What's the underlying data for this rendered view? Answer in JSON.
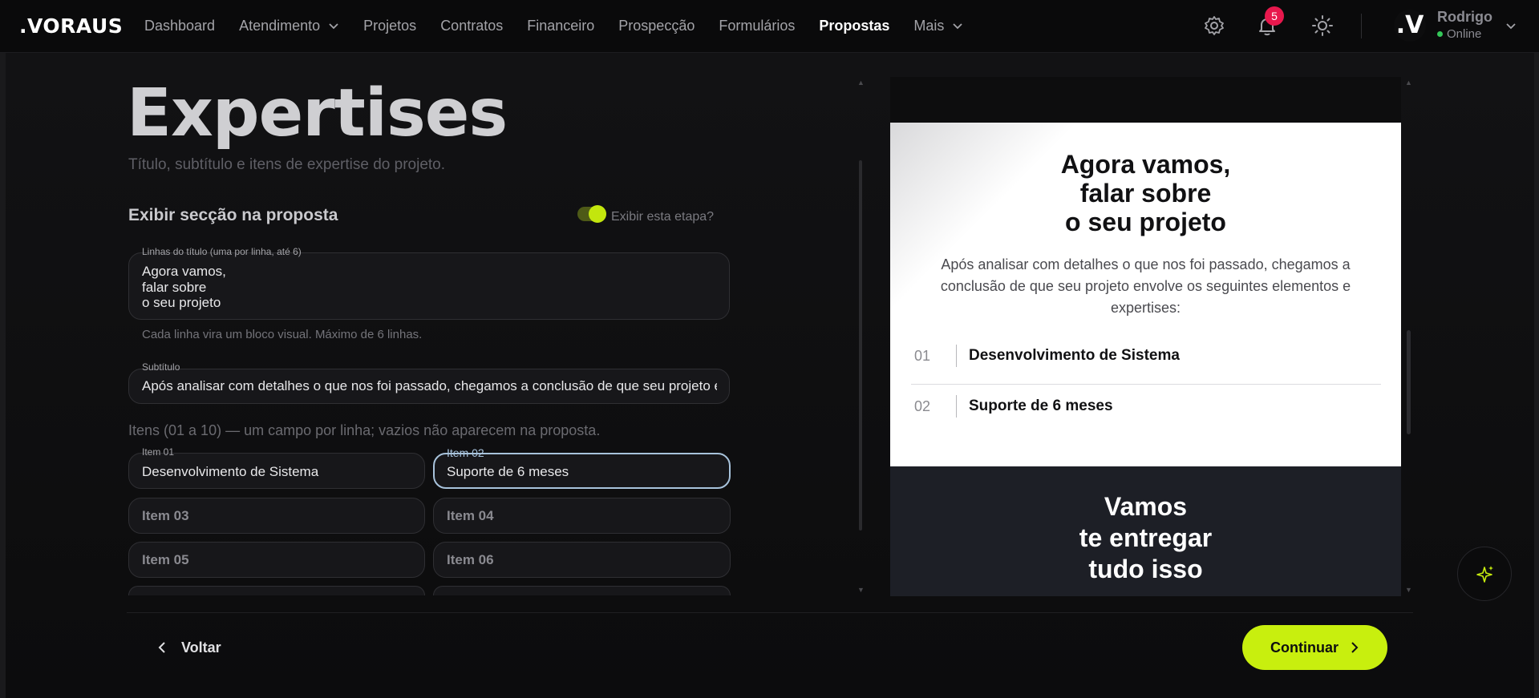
{
  "app": {
    "logo": ".VORAUS"
  },
  "nav": {
    "items": [
      {
        "label": "Dashboard"
      },
      {
        "label": "Atendimento"
      },
      {
        "label": "Projetos"
      },
      {
        "label": "Contratos"
      },
      {
        "label": "Financeiro"
      },
      {
        "label": "Prospecção"
      },
      {
        "label": "Formulários"
      },
      {
        "label": "Propostas"
      },
      {
        "label": "Mais"
      }
    ],
    "active": "Propostas"
  },
  "header": {
    "notification_count": "5",
    "user": {
      "initial": ".V",
      "name": "Rodrigo",
      "status": "Online"
    }
  },
  "form": {
    "title": "Expertises",
    "description": "Título, subtítulo e itens de expertise do projeto.",
    "section_label": "Exibir secção na proposta",
    "toggle_label": "Exibir esta etapa?",
    "title_lines_label": "Linhas do título (uma por linha, até 6)",
    "title_lines_value": "Agora vamos,\nfalar sobre\no seu projeto",
    "title_lines_hint": "Cada linha vira um bloco visual. Máximo de 6 linhas.",
    "subtitle_label": "Subtítulo",
    "subtitle_value": "Após analisar com detalhes o que nos foi passado, chegamos a conclusão de que seu projeto envolve os seguintes elementos e expertises:",
    "items_hint": "Itens (01 a 10) — um campo por linha; vazios não aparecem na proposta.",
    "items": [
      {
        "label": "Item 01",
        "value": "Desenvolvimento de Sistema"
      },
      {
        "label": "Item 02",
        "value": "Suporte de 6 meses"
      },
      {
        "placeholder": "Item 03"
      },
      {
        "placeholder": "Item 04"
      },
      {
        "placeholder": "Item 05"
      },
      {
        "placeholder": "Item 06"
      }
    ]
  },
  "preview": {
    "title": "Agora vamos,\nfalar sobre\no seu projeto",
    "subtitle": "Após analisar com detalhes o que nos foi passado, chegamos a conclusão de que seu projeto envolve os seguintes elementos e expertises:",
    "items": [
      {
        "num": "01",
        "text": "Desenvolvimento de Sistema"
      },
      {
        "num": "02",
        "text": "Suporte de 6 meses"
      }
    ],
    "next_title": "Vamos\nte entregar\ntudo isso"
  },
  "footer": {
    "back_label": "Voltar",
    "continue_label": "Continuar"
  },
  "colors": {
    "accent": "#c8ef0e",
    "badge": "#e8184d",
    "online": "#34c759"
  }
}
